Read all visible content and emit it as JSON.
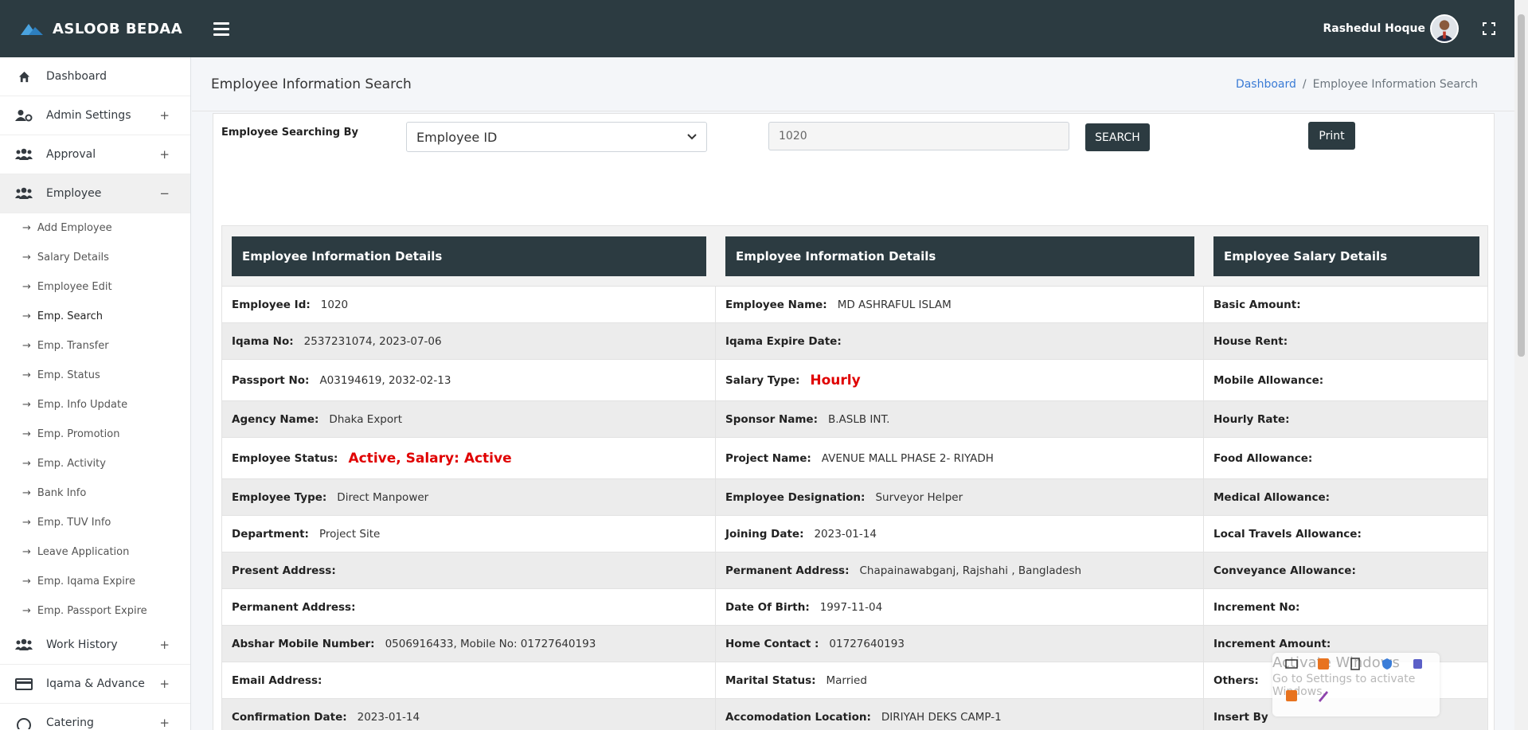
{
  "app": {
    "brand": "ASLOOB BEDAA",
    "user_name": "Rashedul Hoque"
  },
  "sidebar": {
    "items": [
      {
        "label": "Dashboard",
        "icon": "home-icon",
        "toggle": ""
      },
      {
        "label": "Admin Settings",
        "icon": "user-cog-icon",
        "toggle": "+"
      },
      {
        "label": "Approval",
        "icon": "users-icon",
        "toggle": "+"
      },
      {
        "label": "Employee",
        "icon": "users-icon",
        "toggle": "−"
      }
    ],
    "employee_subitems": [
      "Add Employee",
      "Salary Details",
      "Employee Edit",
      "Emp. Search",
      "Emp. Transfer",
      "Emp. Status",
      "Emp. Info Update",
      "Emp. Promotion",
      "Emp. Activity",
      "Bank Info",
      "Emp. TUV Info",
      "Leave Application",
      "Emp. Iqama Expire",
      "Emp. Passport Expire"
    ],
    "bottom_items": [
      {
        "label": "Work History",
        "icon": "users-icon",
        "toggle": "+"
      },
      {
        "label": "Iqama & Advance",
        "icon": "card-icon",
        "toggle": "+"
      },
      {
        "label": "Catering",
        "icon": "dial-icon",
        "toggle": "+"
      }
    ]
  },
  "header": {
    "page_title": "Employee Information Search",
    "breadcrumb_link": "Dashboard",
    "breadcrumb_sep": "/",
    "breadcrumb_current": "Employee Information Search"
  },
  "search": {
    "label": "Employee Searching By",
    "select_value": "Employee ID",
    "input_value": "1020",
    "search_button": "SEARCH",
    "print_button": "Print"
  },
  "details": {
    "headers": [
      "Employee Information Details",
      "Employee Information Details",
      "Employee Salary Details"
    ],
    "rows": [
      [
        {
          "l": "Employee Id:",
          "v": "1020"
        },
        {
          "l": "Employee Name:",
          "v": "MD ASHRAFUL ISLAM"
        },
        {
          "l": "Basic Amount:",
          "v": ""
        }
      ],
      [
        {
          "l": "Iqama No:",
          "v": "2537231074, 2023-07-06"
        },
        {
          "l": "Iqama Expire Date:",
          "v": ""
        },
        {
          "l": "House Rent:",
          "v": ""
        }
      ],
      [
        {
          "l": "Passport No:",
          "v": "A03194619, 2032-02-13"
        },
        {
          "l": "Salary Type:",
          "v": "Hourly",
          "red": true
        },
        {
          "l": "Mobile Allowance:",
          "v": ""
        }
      ],
      [
        {
          "l": "Agency Name:",
          "v": "Dhaka Export"
        },
        {
          "l": "Sponsor Name:",
          "v": "B.ASLB INT."
        },
        {
          "l": "Hourly Rate:",
          "v": ""
        }
      ],
      [
        {
          "l": "Employee Status:",
          "v": "Active, Salary: Active",
          "red": true
        },
        {
          "l": "Project Name:",
          "v": "AVENUE MALL PHASE 2- RIYADH"
        },
        {
          "l": "Food Allowance:",
          "v": ""
        }
      ],
      [
        {
          "l": "Employee Type:",
          "v": "Direct Manpower"
        },
        {
          "l": "Employee Designation:",
          "v": "Surveyor Helper"
        },
        {
          "l": "Medical Allowance:",
          "v": ""
        }
      ],
      [
        {
          "l": "Department:",
          "v": "Project Site"
        },
        {
          "l": "Joining Date:",
          "v": "2023-01-14"
        },
        {
          "l": "Local Travels Allowance:",
          "v": ""
        }
      ],
      [
        {
          "l": "Present Address:",
          "v": ""
        },
        {
          "l": "Permanent Address:",
          "v": "Chapainawabganj, Rajshahi , Bangladesh"
        },
        {
          "l": "Conveyance Allowance:",
          "v": ""
        }
      ],
      [
        {
          "l": "Permanent Address:",
          "v": ""
        },
        {
          "l": "Date Of Birth:",
          "v": "1997-11-04"
        },
        {
          "l": "Increment No:",
          "v": ""
        }
      ],
      [
        {
          "l": "Abshar Mobile Number:",
          "v": "0506916433, Mobile No: 01727640193"
        },
        {
          "l": "Home Contact :",
          "v": "01727640193"
        },
        {
          "l": "Increment Amount:",
          "v": ""
        }
      ],
      [
        {
          "l": "Email Address:",
          "v": ""
        },
        {
          "l": "Marital Status:",
          "v": "Married"
        },
        {
          "l": "Others:",
          "v": ""
        }
      ],
      [
        {
          "l": "Confirmation Date:",
          "v": "2023-01-14"
        },
        {
          "l": "Accomodation Location:",
          "v": "DIRIYAH DEKS CAMP-1"
        },
        {
          "l": "Insert By",
          "v": ""
        }
      ]
    ]
  },
  "watermark": {
    "title": "Activate Windows",
    "subtitle": "Go to Settings to activate Windows."
  },
  "colors": {
    "navbar": "#2c3b41",
    "red_value": "#e00000",
    "link": "#3a7bd5"
  }
}
